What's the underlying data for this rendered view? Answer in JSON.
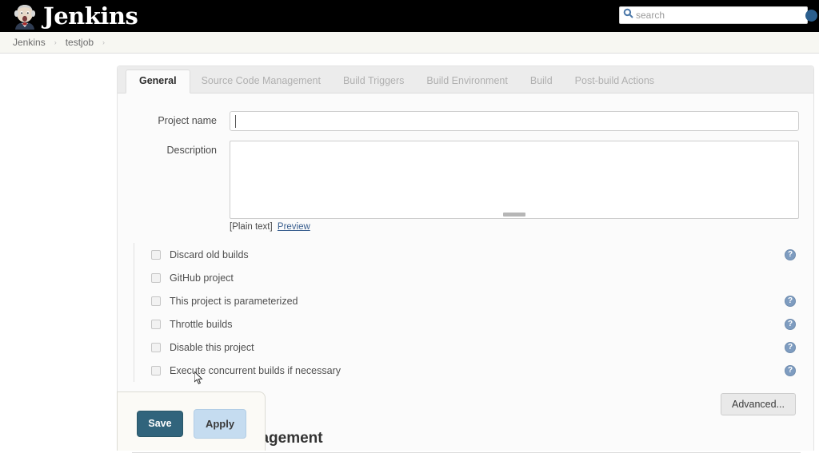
{
  "header": {
    "logo_icon": "jenkins-butler-icon",
    "brand": "Jenkins",
    "search": {
      "icon": "search-icon",
      "placeholder": "search",
      "value": ""
    },
    "right_orb_icon": "account-orb-icon"
  },
  "breadcrumb": {
    "items": [
      {
        "label": "Jenkins"
      },
      {
        "label": "testjob"
      }
    ],
    "separator": "›"
  },
  "tabs": [
    {
      "label": "General",
      "active": true
    },
    {
      "label": "Source Code Management",
      "active": false
    },
    {
      "label": "Build Triggers",
      "active": false
    },
    {
      "label": "Build Environment",
      "active": false
    },
    {
      "label": "Build",
      "active": false
    },
    {
      "label": "Post-build Actions",
      "active": false
    }
  ],
  "form": {
    "project_name": {
      "label": "Project name",
      "value": "",
      "placeholder": ""
    },
    "description": {
      "label": "Description",
      "value": "",
      "placeholder": "",
      "plain_text_note": "[Plain text]",
      "preview_link": "Preview"
    }
  },
  "checkboxes": [
    {
      "label": "Discard old builds",
      "checked": false,
      "help": true,
      "help_glyph": "?"
    },
    {
      "label": "GitHub project",
      "checked": false,
      "help": false,
      "help_glyph": "?"
    },
    {
      "label": "This project is parameterized",
      "checked": false,
      "help": true,
      "help_glyph": "?"
    },
    {
      "label": "Throttle builds",
      "checked": false,
      "help": true,
      "help_glyph": "?"
    },
    {
      "label": "Disable this project",
      "checked": false,
      "help": true,
      "help_glyph": "?"
    },
    {
      "label": "Execute concurrent builds if necessary",
      "checked": false,
      "help": true,
      "help_glyph": "?"
    }
  ],
  "advanced": {
    "label": "Advanced..."
  },
  "section_heading": {
    "label": "Source Code Management"
  },
  "actions": {
    "save_label": "Save",
    "apply_label": "Apply"
  },
  "colors": {
    "topbar_bg": "#000000",
    "save_bg": "#31647c",
    "apply_bg": "#c5dcf0",
    "help_icon": "#7e9cc0",
    "link": "#3a5f8f"
  }
}
